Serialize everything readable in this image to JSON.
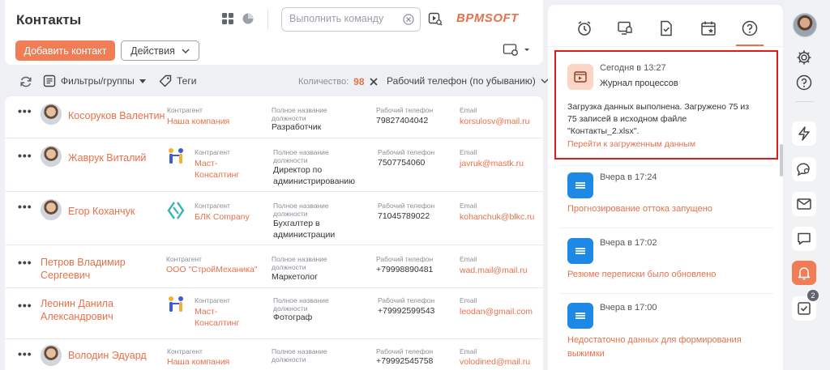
{
  "header": {
    "title": "Контакты",
    "command_placeholder": "Выполнить команду",
    "logo_text": "BPMSOFT"
  },
  "toolbar": {
    "add_label": "Добавить контакт",
    "actions_label": "Действия"
  },
  "filters": {
    "filters_label": "Фильтры/группы",
    "tags_label": "Теги",
    "count_label": "Количество:",
    "count_value": "98",
    "sort_label": "Рабочий телефон (по убыванию)"
  },
  "labels": {
    "account": "Контрагент",
    "job_title": "Полное название должности",
    "phone": "Рабочий телефон",
    "email": "Email"
  },
  "contacts": [
    {
      "name": "Косоруков Валентин",
      "account": "Наша компания",
      "job": "Разработчик",
      "phone": "79827404042",
      "email": "korsulosv@mail.ru",
      "has_avatar": true,
      "account_logo": "none"
    },
    {
      "name": "Жаврук Виталий",
      "account": "Маст-Консалтинг",
      "job": "Директор по администрированию",
      "phone": "7507754060",
      "email": "javruk@mastk.ru",
      "has_avatar": true,
      "account_logo": "people-logo"
    },
    {
      "name": "Егор Коханчук",
      "account": "БЛК Company",
      "job": "Бухгалтер в администрации",
      "phone": "71045789022",
      "email": "kohanchuk@blkc.ru",
      "has_avatar": true,
      "account_logo": "blk-logo"
    },
    {
      "name": "Петров Владимир Сергеевич",
      "account": "ООО \"СтройМеханика\"",
      "job": "Маркетолог",
      "phone": "+79998890481",
      "email": "wad.mail@mail.ru",
      "has_avatar": false,
      "account_logo": "none"
    },
    {
      "name": "Леонин Данила Александрович",
      "account": "Маст-Консалтинг",
      "job": "Фотограф",
      "phone": "+79992599543",
      "email": "leodan@gmail.com",
      "has_avatar": false,
      "account_logo": "people-logo"
    },
    {
      "name": "Володин Эдуард",
      "account": "Наша компания",
      "job": "",
      "phone": "+79992545758",
      "email": "volodined@mail.ru",
      "has_avatar": true,
      "account_logo": "none"
    }
  ],
  "notifications": {
    "tabs": [
      "alarm-clock-icon",
      "device-bell-icon",
      "doc-check-icon",
      "calendar-star-icon",
      "help-icon"
    ],
    "featured": {
      "time": "Сегодня в 13:27",
      "title": "Журнал процессов",
      "text": "Загрузка данных выполнена. Загружено 75 из 75 записей в исходном файле \"Контакты_2.xlsx\".",
      "link": "Перейти к загруженным данным"
    },
    "items": [
      {
        "time": "Вчера в 17:24",
        "text": "Прогнозирование оттока запущено"
      },
      {
        "time": "Вчера в 17:02",
        "text": "Резюме переписки было обновлено"
      },
      {
        "time": "Вчера в 17:00",
        "text": "Недостаточно данных для формирования выжимки"
      }
    ]
  },
  "sidebar": {
    "task_count": "2"
  },
  "colors": {
    "accent": "#e8704a",
    "accent_button": "#f07d55",
    "highlight_border": "#e3191c",
    "notification_badge": "#1e88e5"
  }
}
